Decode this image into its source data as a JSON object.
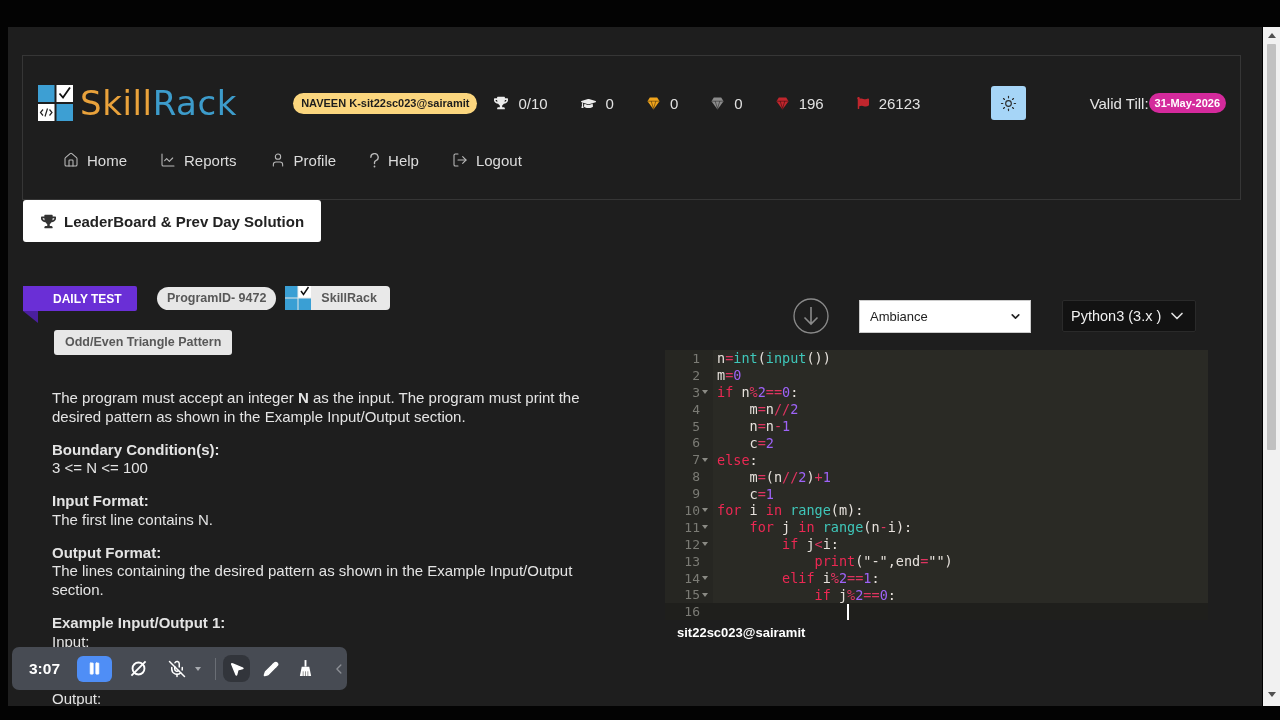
{
  "header": {
    "logo": {
      "parts": [
        {
          "text": "Skill",
          "color": "#e9a23b"
        },
        {
          "text": "Rack",
          "color": "#3d9ccb"
        }
      ]
    },
    "user_badge": "NAVEEN K-sit22sc023@sairamit",
    "stats": [
      {
        "kind": "trophy",
        "value": "0/10",
        "color": "#ececec"
      },
      {
        "kind": "cap",
        "value": "0",
        "color": "#ececec"
      },
      {
        "kind": "badge",
        "value": "0",
        "color": "#f0a41c"
      },
      {
        "kind": "badge",
        "value": "0",
        "color": "#8c8c8c"
      },
      {
        "kind": "badge",
        "value": "196",
        "color": "#c0262d"
      },
      {
        "kind": "flag",
        "value": "26123",
        "color": "#c0262d"
      }
    ],
    "valid_till": {
      "label": "Valid Till:",
      "date": "31-May-2026"
    },
    "nav": [
      {
        "kind": "home",
        "label": "Home"
      },
      {
        "kind": "reports",
        "label": "Reports"
      },
      {
        "kind": "profile",
        "label": "Profile"
      },
      {
        "kind": "help",
        "label": "Help"
      },
      {
        "kind": "logout",
        "label": "Logout"
      }
    ]
  },
  "leaderboard_button": "LeaderBoard & Prev Day Solution",
  "problem": {
    "ribbon": "DAILY TEST",
    "program_id": "ProgramID- 9472",
    "platform": "SkillRack",
    "title": "Odd/Even Triangle Pattern",
    "description": "The program must accept an integer **N** as the input. The program must print the desired pattern as shown in the Example Input/Output section.",
    "sections": [
      {
        "kind": "text",
        "heading": "Boundary Condition(s):",
        "body": "3 <= N <= 100"
      },
      {
        "kind": "text",
        "heading": "Input Format:",
        "body": "The first line contains N."
      },
      {
        "kind": "text",
        "heading": "Output Format:",
        "body": "The lines containing the desired pattern as shown in the Example Input/Output section."
      },
      {
        "kind": "example",
        "heading": "Example Input/Output 1:",
        "input_label": "Input:",
        "output_label": "Output:"
      }
    ]
  },
  "editor": {
    "theme_select": "Ambiance",
    "language_select": "Python3 (3.x )",
    "lines": [
      {
        "number": "1",
        "fold": false,
        "cursor": false,
        "tokens": [
          {
            "kind": "plain",
            "text": "n"
          },
          {
            "kind": "operator",
            "text": "="
          },
          {
            "kind": "builtin",
            "text": "int"
          },
          {
            "kind": "plain",
            "text": "("
          },
          {
            "kind": "builtin",
            "text": "input"
          },
          {
            "kind": "plain",
            "text": "())"
          }
        ]
      },
      {
        "number": "2",
        "fold": false,
        "cursor": false,
        "tokens": [
          {
            "kind": "plain",
            "text": "m"
          },
          {
            "kind": "operator",
            "text": "="
          },
          {
            "kind": "number",
            "text": "0"
          }
        ]
      },
      {
        "number": "3",
        "fold": true,
        "cursor": false,
        "tokens": [
          {
            "kind": "keyword",
            "text": "if"
          },
          {
            "kind": "plain",
            "text": " n"
          },
          {
            "kind": "operator",
            "text": "%"
          },
          {
            "kind": "number",
            "text": "2"
          },
          {
            "kind": "operator",
            "text": "=="
          },
          {
            "kind": "number",
            "text": "0"
          },
          {
            "kind": "plain",
            "text": ":"
          }
        ]
      },
      {
        "number": "4",
        "fold": false,
        "cursor": false,
        "tokens": [
          {
            "kind": "plain",
            "text": "    m"
          },
          {
            "kind": "operator",
            "text": "="
          },
          {
            "kind": "plain",
            "text": "n"
          },
          {
            "kind": "operator",
            "text": "//"
          },
          {
            "kind": "number",
            "text": "2"
          }
        ]
      },
      {
        "number": "5",
        "fold": false,
        "cursor": false,
        "tokens": [
          {
            "kind": "plain",
            "text": "    n"
          },
          {
            "kind": "operator",
            "text": "="
          },
          {
            "kind": "plain",
            "text": "n"
          },
          {
            "kind": "operator",
            "text": "-"
          },
          {
            "kind": "number",
            "text": "1"
          }
        ]
      },
      {
        "number": "6",
        "fold": false,
        "cursor": false,
        "tokens": [
          {
            "kind": "plain",
            "text": "    c"
          },
          {
            "kind": "operator",
            "text": "="
          },
          {
            "kind": "number",
            "text": "2"
          }
        ]
      },
      {
        "number": "7",
        "fold": true,
        "cursor": false,
        "tokens": [
          {
            "kind": "keyword",
            "text": "else"
          },
          {
            "kind": "plain",
            "text": ":"
          }
        ]
      },
      {
        "number": "8",
        "fold": false,
        "cursor": false,
        "tokens": [
          {
            "kind": "plain",
            "text": "    m"
          },
          {
            "kind": "operator",
            "text": "="
          },
          {
            "kind": "plain",
            "text": "(n"
          },
          {
            "kind": "operator",
            "text": "//"
          },
          {
            "kind": "number",
            "text": "2"
          },
          {
            "kind": "plain",
            "text": ")"
          },
          {
            "kind": "operator",
            "text": "+"
          },
          {
            "kind": "number",
            "text": "1"
          }
        ]
      },
      {
        "number": "9",
        "fold": false,
        "cursor": false,
        "tokens": [
          {
            "kind": "plain",
            "text": "    c"
          },
          {
            "kind": "operator",
            "text": "="
          },
          {
            "kind": "number",
            "text": "1"
          }
        ]
      },
      {
        "number": "10",
        "fold": true,
        "cursor": false,
        "tokens": [
          {
            "kind": "keyword",
            "text": "for"
          },
          {
            "kind": "plain",
            "text": " i "
          },
          {
            "kind": "keyword",
            "text": "in"
          },
          {
            "kind": "builtin",
            "text": " range"
          },
          {
            "kind": "plain",
            "text": "(m):"
          }
        ]
      },
      {
        "number": "11",
        "fold": true,
        "cursor": false,
        "tokens": [
          {
            "kind": "keyword",
            "text": "    for"
          },
          {
            "kind": "plain",
            "text": " j "
          },
          {
            "kind": "keyword",
            "text": "in"
          },
          {
            "kind": "builtin",
            "text": " range"
          },
          {
            "kind": "plain",
            "text": "(n"
          },
          {
            "kind": "operator",
            "text": "-"
          },
          {
            "kind": "plain",
            "text": "i):"
          }
        ]
      },
      {
        "number": "12",
        "fold": true,
        "cursor": false,
        "tokens": [
          {
            "kind": "keyword",
            "text": "        if"
          },
          {
            "kind": "plain",
            "text": " j"
          },
          {
            "kind": "operator",
            "text": "<"
          },
          {
            "kind": "plain",
            "text": "i:"
          }
        ]
      },
      {
        "number": "13",
        "fold": false,
        "cursor": false,
        "tokens": [
          {
            "kind": "keyword",
            "text": "            print"
          },
          {
            "kind": "plain",
            "text": "(\"-\",end"
          },
          {
            "kind": "operator",
            "text": "="
          },
          {
            "kind": "plain",
            "text": "\"\")"
          }
        ]
      },
      {
        "number": "14",
        "fold": true,
        "cursor": false,
        "tokens": [
          {
            "kind": "keyword",
            "text": "        elif"
          },
          {
            "kind": "plain",
            "text": " i"
          },
          {
            "kind": "operator",
            "text": "%"
          },
          {
            "kind": "number",
            "text": "2"
          },
          {
            "kind": "operator",
            "text": "=="
          },
          {
            "kind": "number",
            "text": "1"
          },
          {
            "kind": "plain",
            "text": ":"
          }
        ]
      },
      {
        "number": "15",
        "fold": true,
        "cursor": false,
        "tokens": [
          {
            "kind": "keyword",
            "text": "            if"
          },
          {
            "kind": "plain",
            "text": " j"
          },
          {
            "kind": "operator",
            "text": "%"
          },
          {
            "kind": "number",
            "text": "2"
          },
          {
            "kind": "operator",
            "text": "=="
          },
          {
            "kind": "number",
            "text": "0"
          },
          {
            "kind": "plain",
            "text": ":"
          }
        ]
      },
      {
        "number": "16",
        "fold": false,
        "cursor": true
      }
    ],
    "username": "sit22sc023@sairamit"
  },
  "recorder_toolbar": {
    "timer": "3:07",
    "controls": [
      {
        "kind": "pause"
      },
      {
        "kind": "camera_off"
      },
      {
        "kind": "mic_off"
      }
    ],
    "tools": [
      {
        "kind": "pointer",
        "selected": true
      },
      {
        "kind": "pencil",
        "selected": false
      },
      {
        "kind": "broom",
        "selected": false
      }
    ]
  }
}
